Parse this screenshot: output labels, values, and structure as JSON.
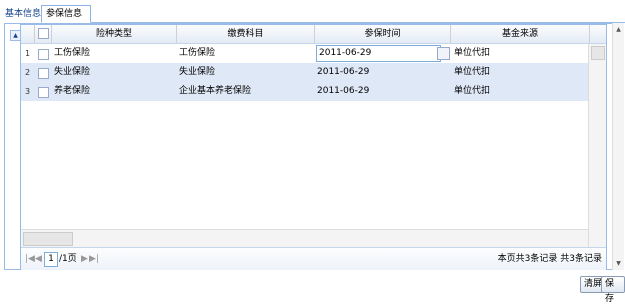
{
  "tabs": [
    {
      "label": "基本信息"
    },
    {
      "label": "参保信息"
    }
  ],
  "grid": {
    "columns": [
      "险种类型",
      "缴费科目",
      "参保时间",
      "基金来源"
    ],
    "rows": [
      {
        "num": "1",
        "type": "工伤保险",
        "subject": "工伤保险",
        "date": "2011-06-29",
        "source": "单位代扣"
      },
      {
        "num": "2",
        "type": "失业保险",
        "subject": "失业保险",
        "date": "2011-06-29",
        "source": "单位代扣"
      },
      {
        "num": "3",
        "type": "养老保险",
        "subject": "企业基本养老保险",
        "date": "2011-06-29",
        "source": "单位代扣"
      }
    ]
  },
  "pager": {
    "page": "1",
    "total_pages": "/1页",
    "summary": "本页共3条记录 共3条记录",
    "first": "|◀",
    "prev": "◀",
    "next": "▶",
    "last": "▶|"
  },
  "buttons": {
    "clear": "清屏",
    "save": "保存"
  },
  "icons": {
    "collapse": "▲",
    "scroll_up": "▲",
    "scroll_down": "▼"
  }
}
